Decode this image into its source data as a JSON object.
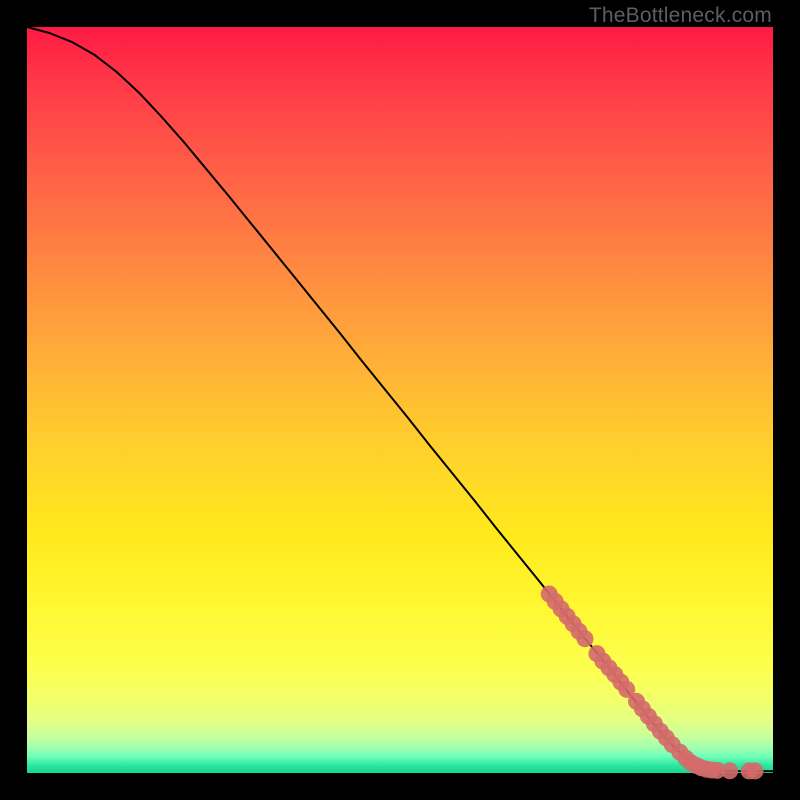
{
  "watermark": "TheBottleneck.com",
  "colors": {
    "curve": "#000000",
    "marker_fill": "#d46a6a",
    "marker_stroke": "#d46a6a",
    "bg": "#000000"
  },
  "chart_data": {
    "type": "line",
    "title": "",
    "xlabel": "",
    "ylabel": "",
    "xlim": [
      0,
      100
    ],
    "ylim": [
      0,
      100
    ],
    "series": [
      {
        "name": "curve",
        "x": [
          0,
          3,
          6,
          9,
          12,
          15,
          18,
          21,
          24,
          27,
          30,
          33,
          36,
          39,
          42,
          45,
          48,
          51,
          54,
          57,
          60,
          63,
          66,
          69,
          72,
          75,
          78,
          81,
          84,
          86,
          88,
          90,
          92,
          94,
          96,
          98,
          100
        ],
        "y": [
          100,
          99.2,
          98.0,
          96.3,
          94.0,
          91.2,
          88.0,
          84.6,
          81.0,
          77.4,
          73.7,
          70.0,
          66.3,
          62.6,
          58.9,
          55.1,
          51.4,
          47.7,
          43.9,
          40.2,
          36.5,
          32.7,
          29.0,
          25.3,
          21.5,
          17.8,
          14.1,
          10.3,
          6.6,
          4.2,
          2.3,
          1.0,
          0.35,
          0.25,
          0.25,
          0.25,
          0.25
        ]
      }
    ],
    "markers": {
      "name": "highlighted-points",
      "x": [
        70.0,
        70.8,
        71.6,
        72.4,
        73.2,
        74.0,
        74.8,
        76.4,
        77.2,
        78.0,
        78.8,
        79.6,
        80.4,
        81.7,
        82.5,
        83.3,
        84.1,
        84.9,
        85.7,
        86.5,
        87.5,
        88.3,
        89.0,
        89.7,
        90.4,
        91.1,
        91.8,
        92.5,
        94.2,
        96.8,
        97.6
      ],
      "y": [
        24.0,
        23.0,
        22.0,
        21.0,
        20.0,
        19.0,
        18.0,
        16.0,
        15.0,
        14.1,
        13.2,
        12.2,
        11.2,
        9.6,
        8.6,
        7.6,
        6.6,
        5.6,
        4.7,
        3.8,
        2.8,
        2.0,
        1.4,
        1.0,
        0.7,
        0.5,
        0.4,
        0.35,
        0.3,
        0.28,
        0.28
      ]
    }
  }
}
